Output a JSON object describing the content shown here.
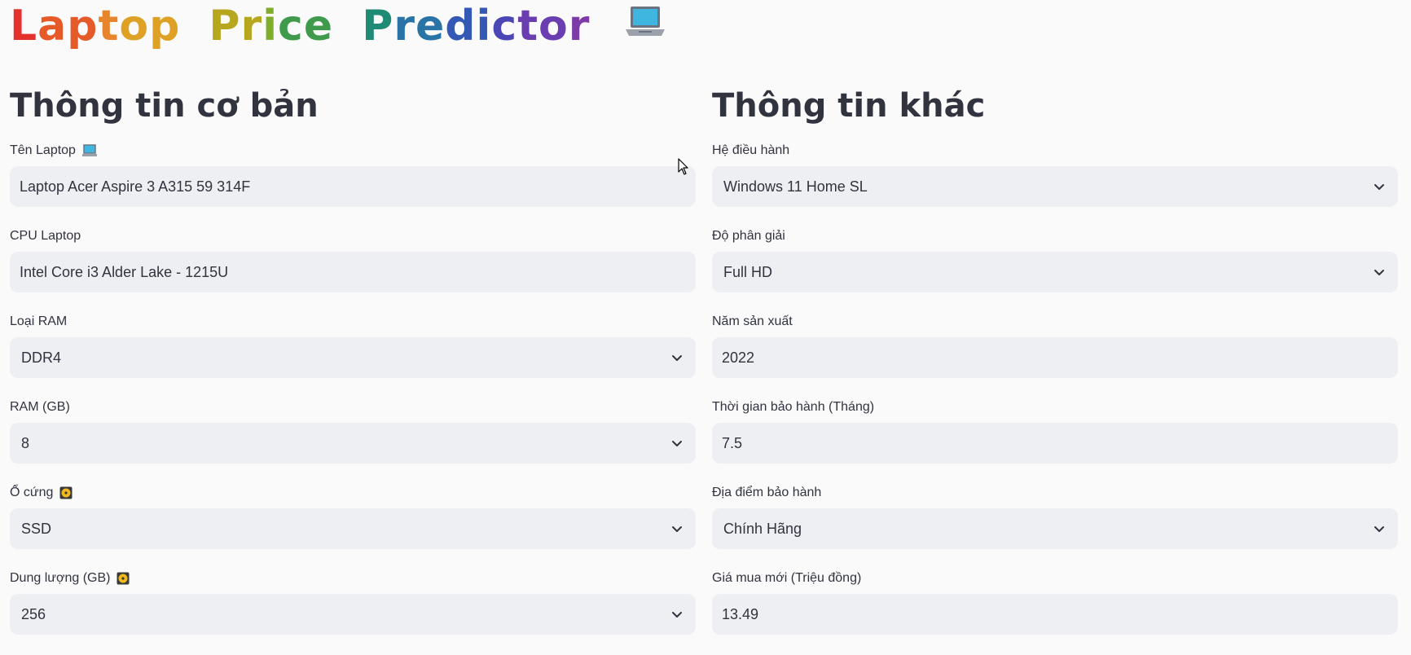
{
  "app": {
    "title_words": [
      "Laptop",
      "Price",
      "Predictor"
    ],
    "title_icon": "laptop-emoji-icon",
    "title_letter_colors": [
      "#e4312b",
      "#e65a2a",
      "#e7852c",
      "#dfa026",
      "#b7a71f",
      "#7fad2b",
      "#3f9b4b",
      "#1f8b74",
      "#2a73a6",
      "#3459b5",
      "#4a46b5",
      "#6a3db0",
      "#7e3aa6"
    ]
  },
  "left": {
    "heading": "Thông tin cơ bản",
    "fields": [
      {
        "label": "Tên Laptop",
        "icon": "laptop-emoji-icon",
        "type": "text",
        "value": "Laptop Acer Aspire 3 A315 59 314F"
      },
      {
        "label": "CPU Laptop",
        "type": "text",
        "value": "Intel Core i3 Alder Lake - 1215U"
      },
      {
        "label": "Loại RAM",
        "type": "select",
        "value": "DDR4"
      },
      {
        "label": "RAM (GB)",
        "type": "select",
        "value": "8"
      },
      {
        "label": "Ổ cứng",
        "icon": "disk-emoji-icon",
        "type": "select",
        "value": "SSD"
      },
      {
        "label": "Dung lượng (GB)",
        "icon": "disk-emoji-icon",
        "type": "select",
        "value": "256"
      }
    ]
  },
  "right": {
    "heading": "Thông tin khác",
    "fields": [
      {
        "label": "Hệ điều hành",
        "type": "select",
        "value": "Windows 11 Home SL"
      },
      {
        "label": "Độ phân giải",
        "type": "select",
        "value": "Full HD"
      },
      {
        "label": "Năm sản xuất",
        "type": "number",
        "value": "2022"
      },
      {
        "label": "Thời gian bảo hành (Tháng)",
        "type": "number",
        "value": "7.5"
      },
      {
        "label": "Địa điểm bảo hành",
        "type": "select",
        "value": "Chính Hãng"
      },
      {
        "label": "Giá mua mới (Triệu đồng)",
        "type": "number",
        "value": "13.49"
      }
    ]
  },
  "colors": {
    "background": "#fafafa",
    "input_background": "#eeeff2",
    "text": "#31333f"
  }
}
